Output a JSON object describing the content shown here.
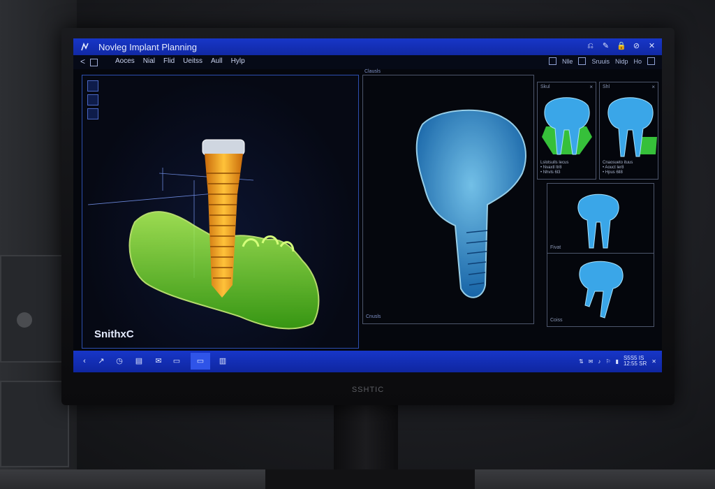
{
  "window": {
    "title": "Novleg Implant Planning",
    "controls": [
      "⎌",
      "✎",
      "🔒",
      "⊘",
      "✕"
    ]
  },
  "menubar": {
    "back": "<",
    "items": [
      "Aoces",
      "Nial",
      "Flid",
      "Ueitss",
      "Aull",
      "Hylp"
    ],
    "right": [
      "Nlle",
      "Sruuis",
      "Nidp",
      "Ho"
    ]
  },
  "left_viewport": {
    "watermark": "SnithxC"
  },
  "right_viewport": {
    "label": "Clausls",
    "bottom_label": "Cnusls"
  },
  "thumb_panels": [
    {
      "label": "Skul",
      "caption": "Lslotsulls lecus\n• Nvaxtl ltr8\n• Nhvls 6l3"
    },
    {
      "label": "Shl",
      "caption": "Cnaosueto ituus\n• Aouct ler8\n• Hpus 6ll8"
    },
    {
      "label": "Fivat"
    },
    {
      "label": "Coiss"
    }
  ],
  "taskbar": {
    "icons": [
      "back-arrow",
      "forward-arrow",
      "clock",
      "files",
      "mail",
      "monitor",
      "app-active",
      "app-window"
    ],
    "clock_time": "S5S5 IS",
    "clock_date": "12:55 SR"
  },
  "monitor": {
    "brand": "SSHTIC"
  },
  "colors": {
    "titlebar": "#1736c8",
    "taskbar": "#1330b8",
    "bone_green": "#8ef23a",
    "implant_orange": "#f2a21a",
    "xray_blue": "#3aa6e8"
  }
}
